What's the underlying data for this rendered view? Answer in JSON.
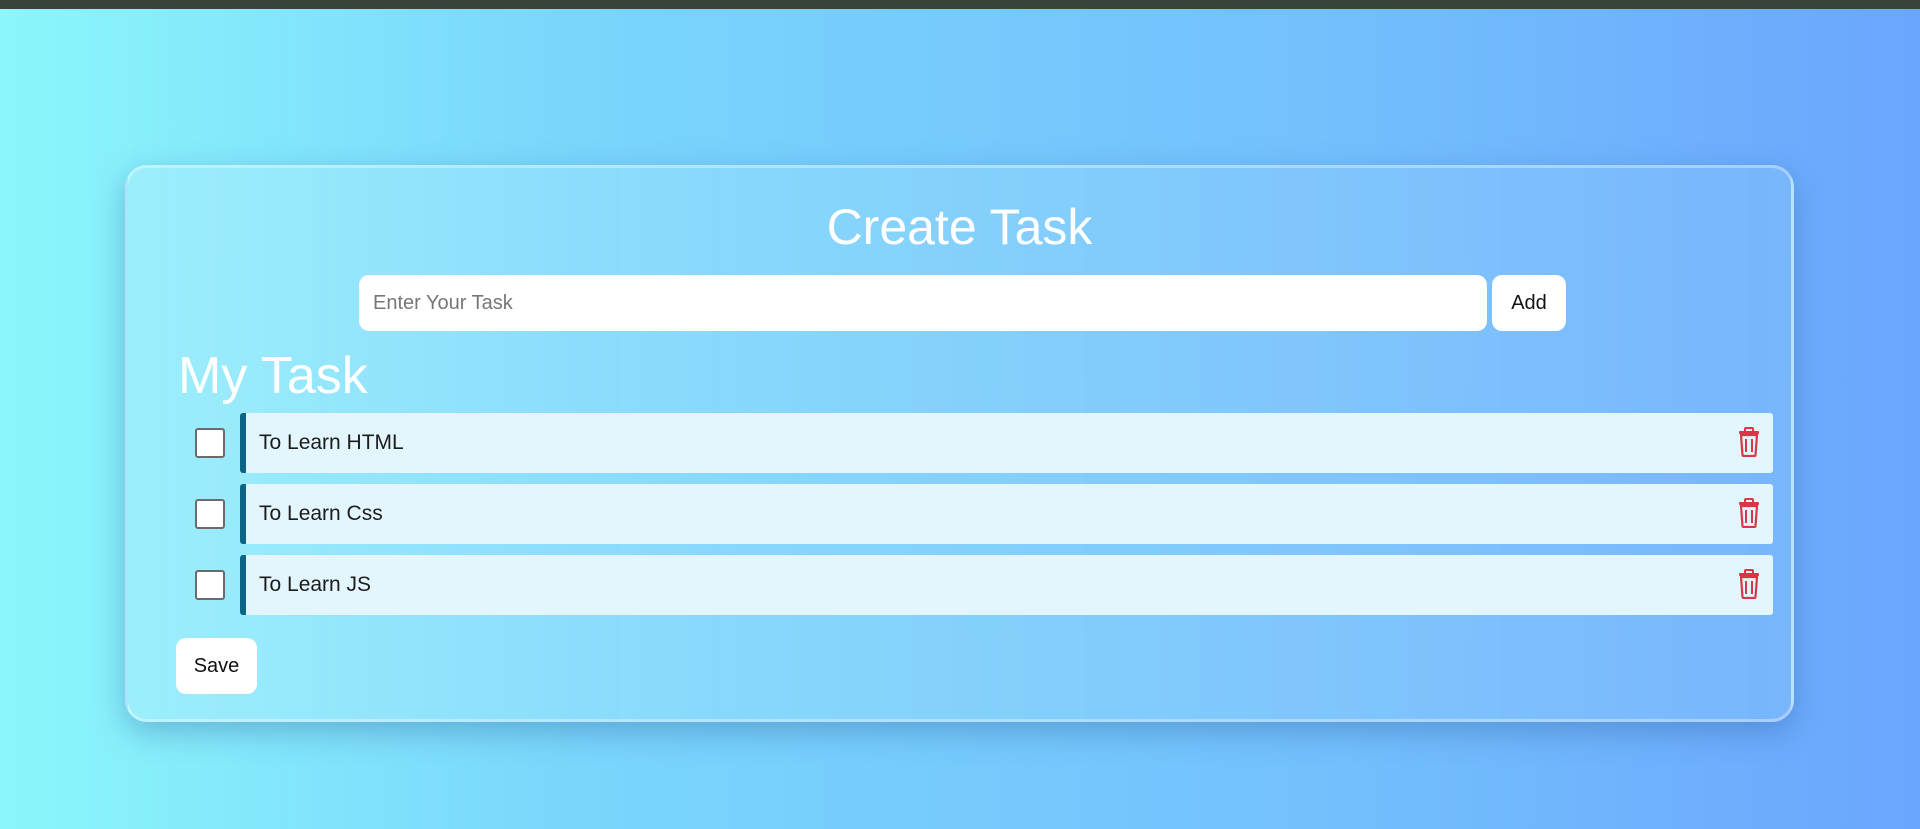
{
  "app": {
    "title": "Create Task"
  },
  "input": {
    "placeholder": "Enter Your Task",
    "value": "",
    "add_label": "Add"
  },
  "section": {
    "title": "My Task"
  },
  "tasks": [
    {
      "label": "To Learn HTML",
      "checked": false,
      "delete_icon": "trash-icon"
    },
    {
      "label": "To Learn Css",
      "checked": false,
      "delete_icon": "trash-icon"
    },
    {
      "label": "To Learn JS",
      "checked": false,
      "delete_icon": "trash-icon"
    }
  ],
  "footer": {
    "save_label": "Save"
  },
  "colors": {
    "background_start": "#8cf6fb",
    "background_end": "#6aa6fd",
    "top_bar": "#37453a",
    "task_accent": "#0c6683",
    "task_background": "#e4f6fd",
    "delete_icon": "#dc3545"
  }
}
